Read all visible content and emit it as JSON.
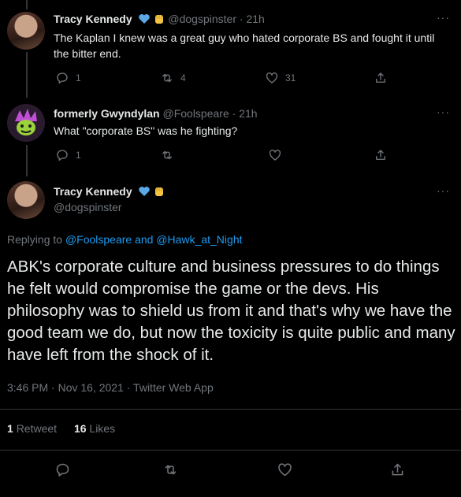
{
  "tweets": [
    {
      "name": "Tracy Kennedy",
      "handle": "@dogspinster",
      "time": "21h",
      "text": "The Kaplan I knew was a great guy who hated corporate BS and fought it until the bitter end.",
      "replies": "1",
      "retweets": "4",
      "likes": "31",
      "badges": [
        "blue-heart-icon",
        "fist-icon"
      ]
    },
    {
      "name": "formerly Gwyndylan",
      "handle": "@Foolspeare",
      "time": "21h",
      "text": "What \"corporate BS\" was he fighting?",
      "replies": "1"
    }
  ],
  "main": {
    "name": "Tracy Kennedy",
    "handle": "@dogspinster",
    "replying_prefix": "Replying to ",
    "replying_to_1": "@Foolspeare",
    "replying_and": " and ",
    "replying_to_2": "@Hawk_at_Night",
    "text": "ABK's corporate culture and business pressures to do things he felt would compromise the game or the devs. His philosophy was to shield us from it and that's why we have the good team we do, but now the toxicity is quite public and many have left from the shock of it.",
    "timestamp": "3:46 PM · Nov 16, 2021 · Twitter Web App",
    "retweet_count": "1",
    "retweet_label": "Retweet",
    "like_count": "16",
    "like_label": "Likes"
  },
  "more_label": "···",
  "dot": "·",
  "colors": {
    "background": "#000000",
    "text": "#e7e9ea",
    "muted": "#71767b",
    "link": "#1d9bf0",
    "heart": "#5aa9e6",
    "fist": "#f5c542"
  }
}
